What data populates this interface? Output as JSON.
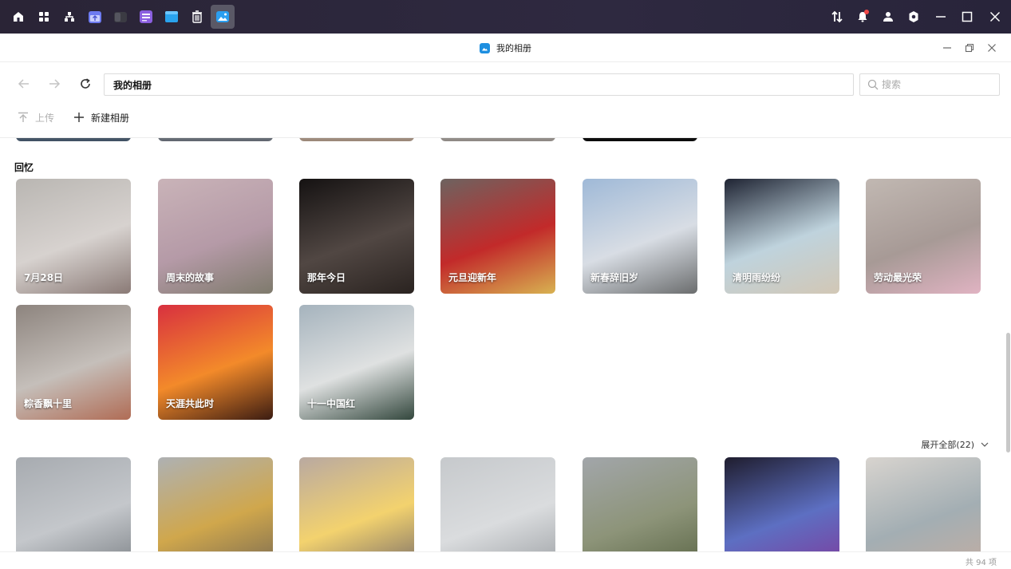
{
  "window": {
    "title": "我的相册",
    "accent": "#1e8fe0"
  },
  "navigation": {
    "path": "我的相册",
    "search_placeholder": "搜索"
  },
  "toolbar": {
    "upload_label": "上传",
    "new_album_label": "新建相册"
  },
  "memories": {
    "title": "回忆",
    "items": [
      {
        "caption": "7月28日",
        "colors": [
          "#b9b6b2",
          "#d7d2cf",
          "#8a7a76"
        ]
      },
      {
        "caption": "周末的故事",
        "colors": [
          "#c9b3b8",
          "#b59aa7",
          "#7e7a6c"
        ]
      },
      {
        "caption": "那年今日",
        "colors": [
          "#151212",
          "#514743",
          "#2a2320"
        ]
      },
      {
        "caption": "元旦迎新年",
        "colors": [
          "#6d6360",
          "#c22a2a",
          "#d8b251"
        ]
      },
      {
        "caption": "新春辞旧岁",
        "colors": [
          "#9fb9d7",
          "#d8dde4",
          "#6b6d6e"
        ]
      },
      {
        "caption": "清明雨纷纷",
        "colors": [
          "#1f2433",
          "#bfd3dd",
          "#d2c7b5"
        ]
      },
      {
        "caption": "劳动最光荣",
        "colors": [
          "#c1b8b2",
          "#a79a96",
          "#e0b3c2"
        ]
      },
      {
        "caption": "粽香飘十里",
        "colors": [
          "#8d847e",
          "#c5bfba",
          "#b06c55"
        ]
      },
      {
        "caption": "天涯共此时",
        "colors": [
          "#d8303f",
          "#f38a2a",
          "#3b1c12"
        ]
      },
      {
        "caption": "十一中国红",
        "colors": [
          "#a5b3bd",
          "#dfe1e1",
          "#33473d"
        ]
      }
    ]
  },
  "section2": {
    "expand_label": "展开全部(22)",
    "items": [
      {
        "colors": [
          "#a7abb0",
          "#c4c7cb",
          "#7d8287"
        ]
      },
      {
        "colors": [
          "#aeb1b3",
          "#d0a74c",
          "#7a6b52"
        ]
      },
      {
        "colors": [
          "#b9a9a1",
          "#f3d26e",
          "#7a6e69"
        ]
      },
      {
        "colors": [
          "#c6c9cc",
          "#dadcde",
          "#9ea2a6"
        ]
      },
      {
        "colors": [
          "#a2a6aa",
          "#8d9479",
          "#5b6646"
        ]
      },
      {
        "colors": [
          "#1f1d2e",
          "#5d6fc2",
          "#7e3c9d"
        ]
      },
      {
        "colors": [
          "#d8d4cf",
          "#a3aeb3",
          "#c3ada2"
        ]
      }
    ]
  },
  "status": {
    "count_label": "共 94 项"
  }
}
